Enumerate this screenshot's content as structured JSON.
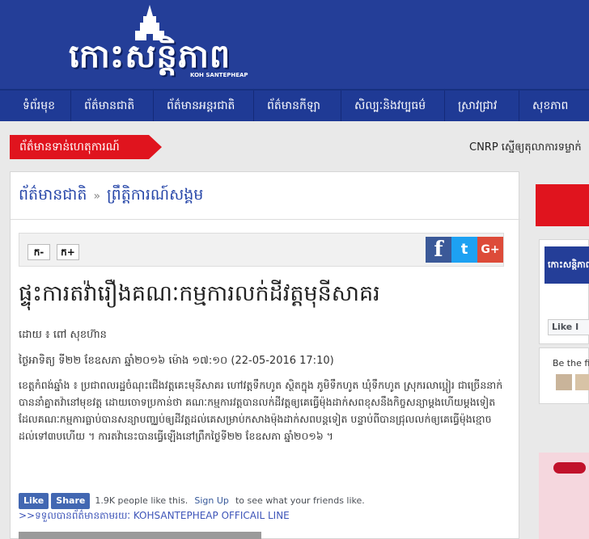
{
  "header": {
    "site_title": "កោះសន្តិភាព",
    "site_subtitle": "KOH SANTEPHEAP"
  },
  "nav": {
    "items": [
      {
        "label": "ទំព័រមុខ"
      },
      {
        "label": "ព័ត៌មានជាតិ"
      },
      {
        "label": "ព័ត៌មានអន្តរជាតិ"
      },
      {
        "label": "ព័ត៌មានកីឡា"
      },
      {
        "label": "សិល្បៈនិងវប្បធម៌"
      },
      {
        "label": "ស្រាវជ្រាវ"
      },
      {
        "label": "សុខភាព"
      }
    ]
  },
  "breaking": {
    "label": "ព័ត៌មានទាន់ហេតុការណ៍",
    "ticker_text": "CNRP ស្នើឲ្យតុលាការទម្លាក់"
  },
  "article": {
    "breadcrumb": {
      "category": "ព័ត៌មានជាតិ",
      "separator": "»",
      "subcategory": "ព្រឹត្តិការណ៍សង្គម"
    },
    "toolbar": {
      "font_decrease": "ក-",
      "font_increase": "ក+"
    },
    "share": {
      "facebook_icon": "f",
      "twitter_icon": "t",
      "googleplus_icon": "G+",
      "colors": {
        "facebook": "#3b5998",
        "twitter": "#1da1f2",
        "googleplus": "#dd4b39"
      }
    },
    "title": "ផ្ទុះការតវ៉ារឿងគណៈកម្មការលក់ដីវត្តមុនីសាគរ",
    "author": "ដោយ ៖ ពៅ សុខហ៊ាន",
    "date": "ថ្ងៃអាទិត្យ ទី២២ ខែឧសភា ឆ្នាំ២០១៦ ម៉ោង ១៧:១០   (22-05-2016 17:10)",
    "body": "ខេត្តកំពង់ឆ្នាំង ៖ ប្រជាពលរដ្ឋចំណុះជើងវត្តគេះមុនីសាគរ ហៅវត្តទឹកហូត ស្ថិតក្នុង ភូមិទឹកហូត ឃុំទឹកហូត ស្រុករលាប្អៀរ ជាច្រើននាក់បាននាំគ្នាតវ៉ានៅមុខវត្ត ដោយចោទប្រកាន់ថា គណៈកម្មការវត្តបានលក់ដីវត្តឲ្យគេធ្វើម៉ុងដាក់សពខុសនឹងកិច្ចសន្យាម្តងហើយម្តងទៀត ដែលគណៈកម្មការធ្លាប់បានសន្យាបញ្ឈប់ឲ្យដីវត្តដល់គេសម្រាប់កសាងម៉ុងដាក់សពបន្តទៀត បន្ទាប់ពីបានជ្រុលលក់ឲ្យគេធ្វើម៉ុងខ្មោចដល់ទៅ៣បហើយ ។ ការតវ៉ានេះបានធ្វើឡើងនៅព្រឹកថ្ងៃទី២២ ខែឧសភា ឆ្នាំ២០១៦ ។",
    "facebook": {
      "like_label": "Like",
      "share_label": "Share",
      "count_text": "1.9K people like this.",
      "signup_label": "Sign Up",
      "signup_suffix": "to see what your friends like."
    },
    "line_link": ">>ទទួលបានព័ត៌មានតាមរយៈ KOHSANTEPHEAP OFFICAIL LINE"
  },
  "sidebar": {
    "widget_logo_text": "កោះសន្តិភាព",
    "widget_like": "Like I",
    "first_friends": "Be the fi"
  }
}
